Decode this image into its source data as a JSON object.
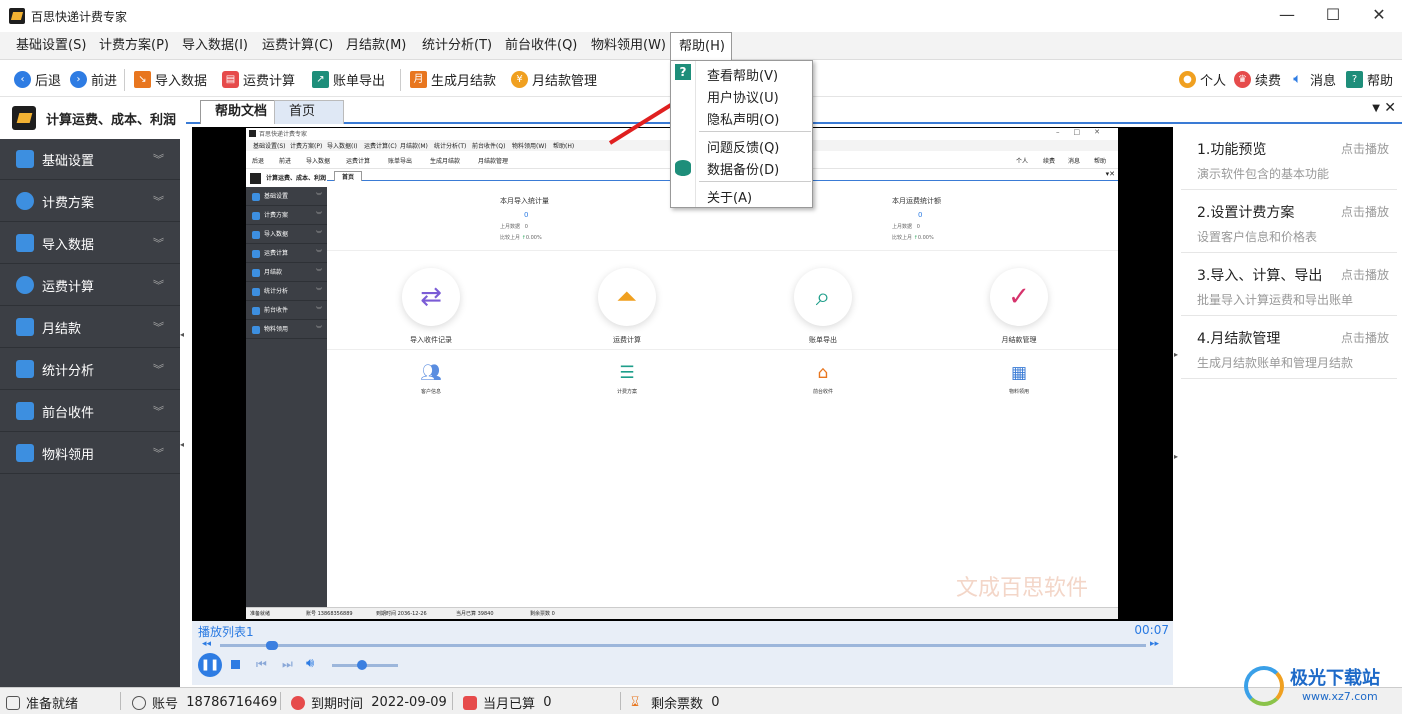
{
  "window": {
    "title": "百思快递计费专家"
  },
  "menu": {
    "items": [
      "基础设置(S)",
      "计费方案(P)",
      "导入数据(I)",
      "运费计算(C)",
      "月结款(M)",
      "统计分析(T)",
      "前台收件(Q)",
      "物料领用(W)",
      "帮助(H)"
    ]
  },
  "toolbar": {
    "back": "后退",
    "forward": "前进",
    "import": "导入数据",
    "calc": "运费计算",
    "export": "账单导出",
    "gen_monthly": "生成月结款",
    "monthly_mgmt": "月结款管理",
    "personal": "个人",
    "renew": "续费",
    "message": "消息",
    "help": "帮助"
  },
  "sidebar": {
    "header": "计算运费、成本、利润",
    "items": [
      "基础设置",
      "计费方案",
      "导入数据",
      "运费计算",
      "月结款",
      "统计分析",
      "前台收件",
      "物料领用"
    ]
  },
  "tabs": [
    "帮助文档",
    "首页"
  ],
  "help_menu": {
    "items": [
      "查看帮助(V)",
      "用户协议(U)",
      "隐私声明(O)",
      "问题反馈(Q)",
      "数据备份(D)",
      "关于(A)"
    ]
  },
  "video": {
    "playlist": "播放列表1",
    "time": "00:07",
    "progress": 0.05,
    "volume": 0.45,
    "inner": {
      "title": "百思快递计费专家",
      "menu": [
        "基础设置(S)",
        "计费方案(P)",
        "导入数据(I)",
        "运费计算(C)",
        "月结款(M)",
        "统计分析(T)",
        "前台收件(Q)",
        "物料领用(W)",
        "帮助(H)"
      ],
      "toolbar": [
        "后退",
        "前进",
        "导入数据",
        "运费计算",
        "账单导出",
        "生成月结款",
        "月结款管理"
      ],
      "toolbar_right": [
        "个人",
        "续费",
        "消息",
        "帮助"
      ],
      "sidebar_header": "计算运费、成本、利润",
      "sidebar": [
        "基础设置",
        "计费方案",
        "导入数据",
        "运费计算",
        "月结款",
        "统计分析",
        "前台收件",
        "物料领用"
      ],
      "tab": "首页",
      "stat_left": {
        "title": "本月导入统计量",
        "value": "0",
        "prev_label": "上月数据",
        "prev_value": "0",
        "cmp_label": "比较上月",
        "cmp_value": "0.00%"
      },
      "stat_right": {
        "title": "本月运费统计额",
        "value": "0",
        "prev_label": "上月数据",
        "prev_value": "0",
        "cmp_label": "比较上月",
        "cmp_value": "0.00%"
      },
      "big_icons": [
        "导入收件记录",
        "运费计算",
        "账单导出",
        "月结款管理"
      ],
      "small_icons": [
        "客户信息",
        "计费方案",
        "前台收件",
        "物料领用"
      ],
      "watermark": "文成百思软件",
      "status": [
        "准备就绪",
        "账号 13868356889",
        "到期时间 2036-12-26",
        "当月已算 39840",
        "剩余票数 0"
      ]
    }
  },
  "help_items": [
    {
      "title": "1.功能预览",
      "play": "点击播放",
      "desc": "演示软件包含的基本功能"
    },
    {
      "title": "2.设置计费方案",
      "play": "点击播放",
      "desc": "设置客户信息和价格表"
    },
    {
      "title": "3.导入、计算、导出",
      "play": "点击播放",
      "desc": "批量导入计算运费和导出账单"
    },
    {
      "title": "4.月结款管理",
      "play": "点击播放",
      "desc": "生成月结款账单和管理月结款"
    }
  ],
  "status": {
    "ready": "准备就绪",
    "account_label": "账号",
    "account": "18786716469",
    "expire_label": "到期时间",
    "expire": "2022-09-09",
    "calc_label": "当月已算",
    "calc": "0",
    "remain_label": "剩余票数",
    "remain": "0"
  },
  "watermark": {
    "brand": "极光下载站",
    "url": "www.xz7.com"
  },
  "colors": {
    "accent": "#2e7ce3",
    "sidebar": "#3c3f45",
    "arrow": "#e02020"
  }
}
